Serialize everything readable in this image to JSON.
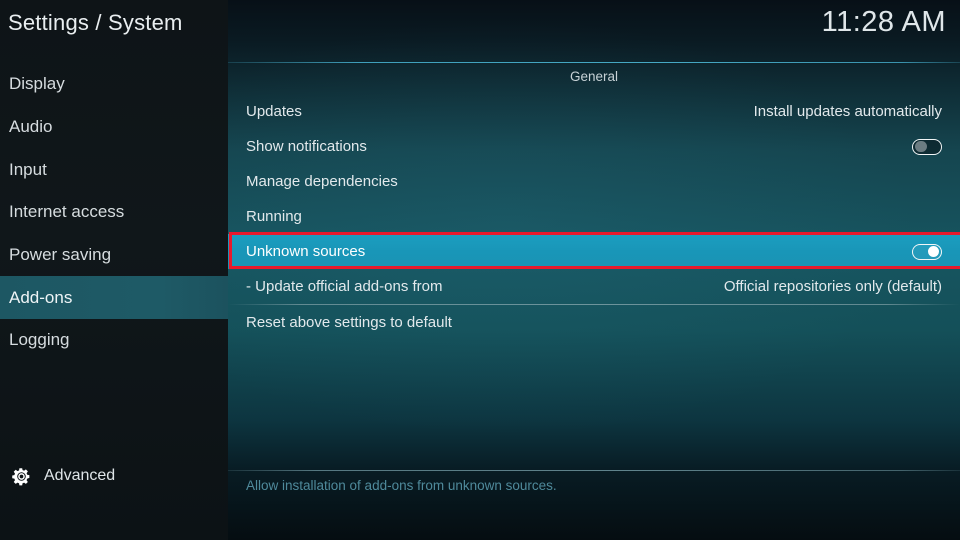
{
  "header": {
    "title": "Settings / System",
    "clock": "11:28 AM"
  },
  "sidebar": {
    "items": [
      {
        "label": "Display",
        "selected": false
      },
      {
        "label": "Audio",
        "selected": false
      },
      {
        "label": "Input",
        "selected": false
      },
      {
        "label": "Internet access",
        "selected": false
      },
      {
        "label": "Power saving",
        "selected": false
      },
      {
        "label": "Add-ons",
        "selected": true
      },
      {
        "label": "Logging",
        "selected": false
      }
    ],
    "footer": {
      "icon": "gear-icon",
      "label": "Advanced"
    }
  },
  "main": {
    "category": "General",
    "rows": [
      {
        "label": "Updates",
        "value": "Install updates automatically",
        "control": "none",
        "highlighted": false,
        "separator_after": false
      },
      {
        "label": "Show notifications",
        "value": "",
        "control": "toggle-off",
        "highlighted": false,
        "separator_after": false
      },
      {
        "label": "Manage dependencies",
        "value": "",
        "control": "none",
        "highlighted": false,
        "separator_after": false
      },
      {
        "label": "Running",
        "value": "",
        "control": "none",
        "highlighted": false,
        "separator_after": false
      },
      {
        "label": "Unknown sources",
        "value": "",
        "control": "toggle-on",
        "highlighted": true,
        "separator_after": false
      },
      {
        "label": "- Update official add-ons from",
        "value": "Official repositories only (default)",
        "control": "none",
        "highlighted": false,
        "separator_after": true
      },
      {
        "label": "Reset above settings to default",
        "value": "",
        "control": "none",
        "highlighted": false,
        "separator_after": false
      }
    ],
    "description": "Allow installation of add-ons from unknown sources."
  },
  "annotation": {
    "target": "Unknown sources",
    "color": "#e8192c"
  },
  "colors": {
    "highlight": "#1996b8",
    "sidebar_selected": "#1d5763",
    "accent_rule": "#46a9c4",
    "description_text": "#4f8a9b"
  }
}
